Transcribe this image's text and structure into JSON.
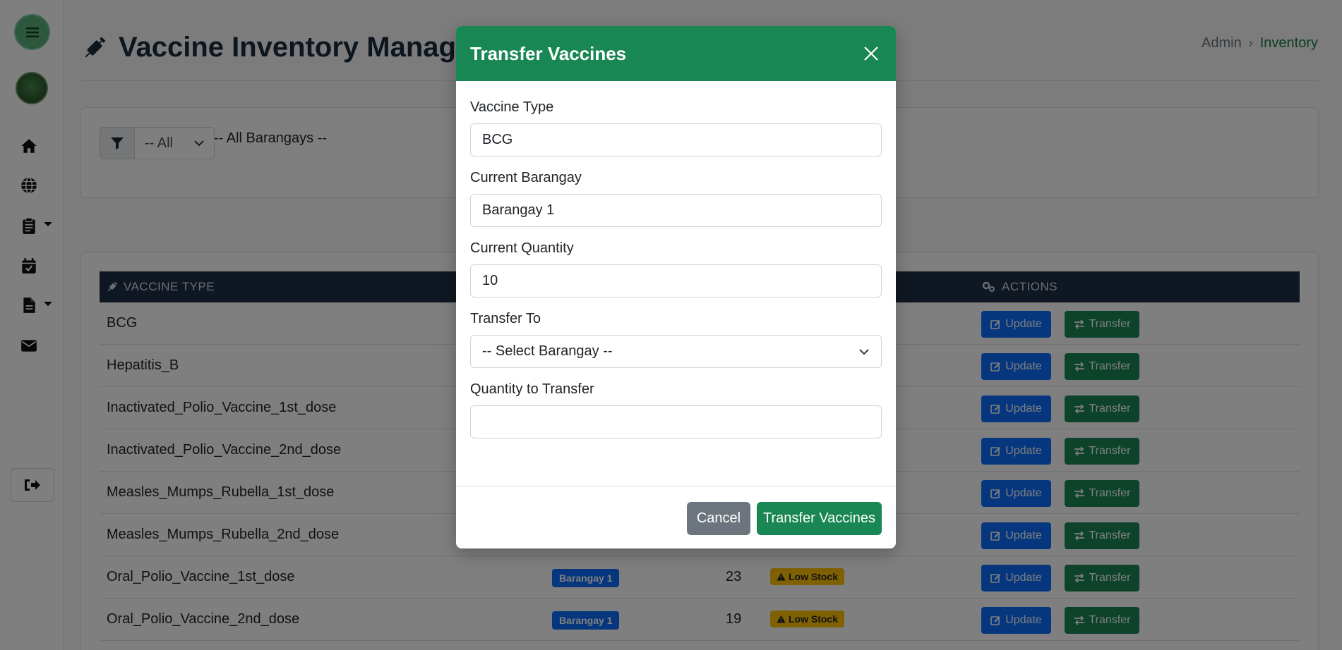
{
  "page": {
    "title": "Vaccine Inventory Management",
    "breadcrumb": {
      "admin": "Admin",
      "current": "Inventory"
    }
  },
  "sidebar": {
    "icons": [
      "menu-icon",
      "logo",
      "home-icon",
      "globe-icon",
      "clipboard-icon",
      "calendar-check-icon",
      "file-icon",
      "envelope-icon",
      "logout-icon"
    ]
  },
  "filter": {
    "select_value": "-- All",
    "label": "-- All Barangays --"
  },
  "table": {
    "headers": {
      "vaccine_type": "VACCINE TYPE",
      "actions": "ACTIONS"
    },
    "update_label": "Update",
    "transfer_label": "Transfer",
    "rows": [
      {
        "name": "BCG"
      },
      {
        "name": "Hepatitis_B"
      },
      {
        "name": "Inactivated_Polio_Vaccine_1st_dose"
      },
      {
        "name": "Inactivated_Polio_Vaccine_2nd_dose"
      },
      {
        "name": "Measles_Mumps_Rubella_1st_dose"
      },
      {
        "name": "Measles_Mumps_Rubella_2nd_dose"
      },
      {
        "name": "Oral_Polio_Vaccine_1st_dose",
        "barangay": "Barangay 1",
        "quantity": "23",
        "status": "Low Stock"
      },
      {
        "name": "Oral_Polio_Vaccine_2nd_dose",
        "barangay": "Barangay 1",
        "quantity": "19",
        "status": "Low Stock"
      }
    ]
  },
  "modal": {
    "title": "Transfer Vaccines",
    "fields": {
      "vaccine_type": {
        "label": "Vaccine Type",
        "value": "BCG"
      },
      "current_barangay": {
        "label": "Current Barangay",
        "value": "Barangay 1"
      },
      "current_quantity": {
        "label": "Current Quantity",
        "value": "10"
      },
      "transfer_to": {
        "label": "Transfer To",
        "value": "-- Select Barangay --"
      },
      "quantity_to_transfer": {
        "label": "Quantity to Transfer",
        "value": ""
      }
    },
    "cancel_label": "Cancel",
    "submit_label": "Transfer Vaccines"
  },
  "colors": {
    "primary_green": "#198754",
    "primary_blue": "#0d6efd",
    "warning": "#ffc107",
    "table_header": "#1f2e44"
  }
}
